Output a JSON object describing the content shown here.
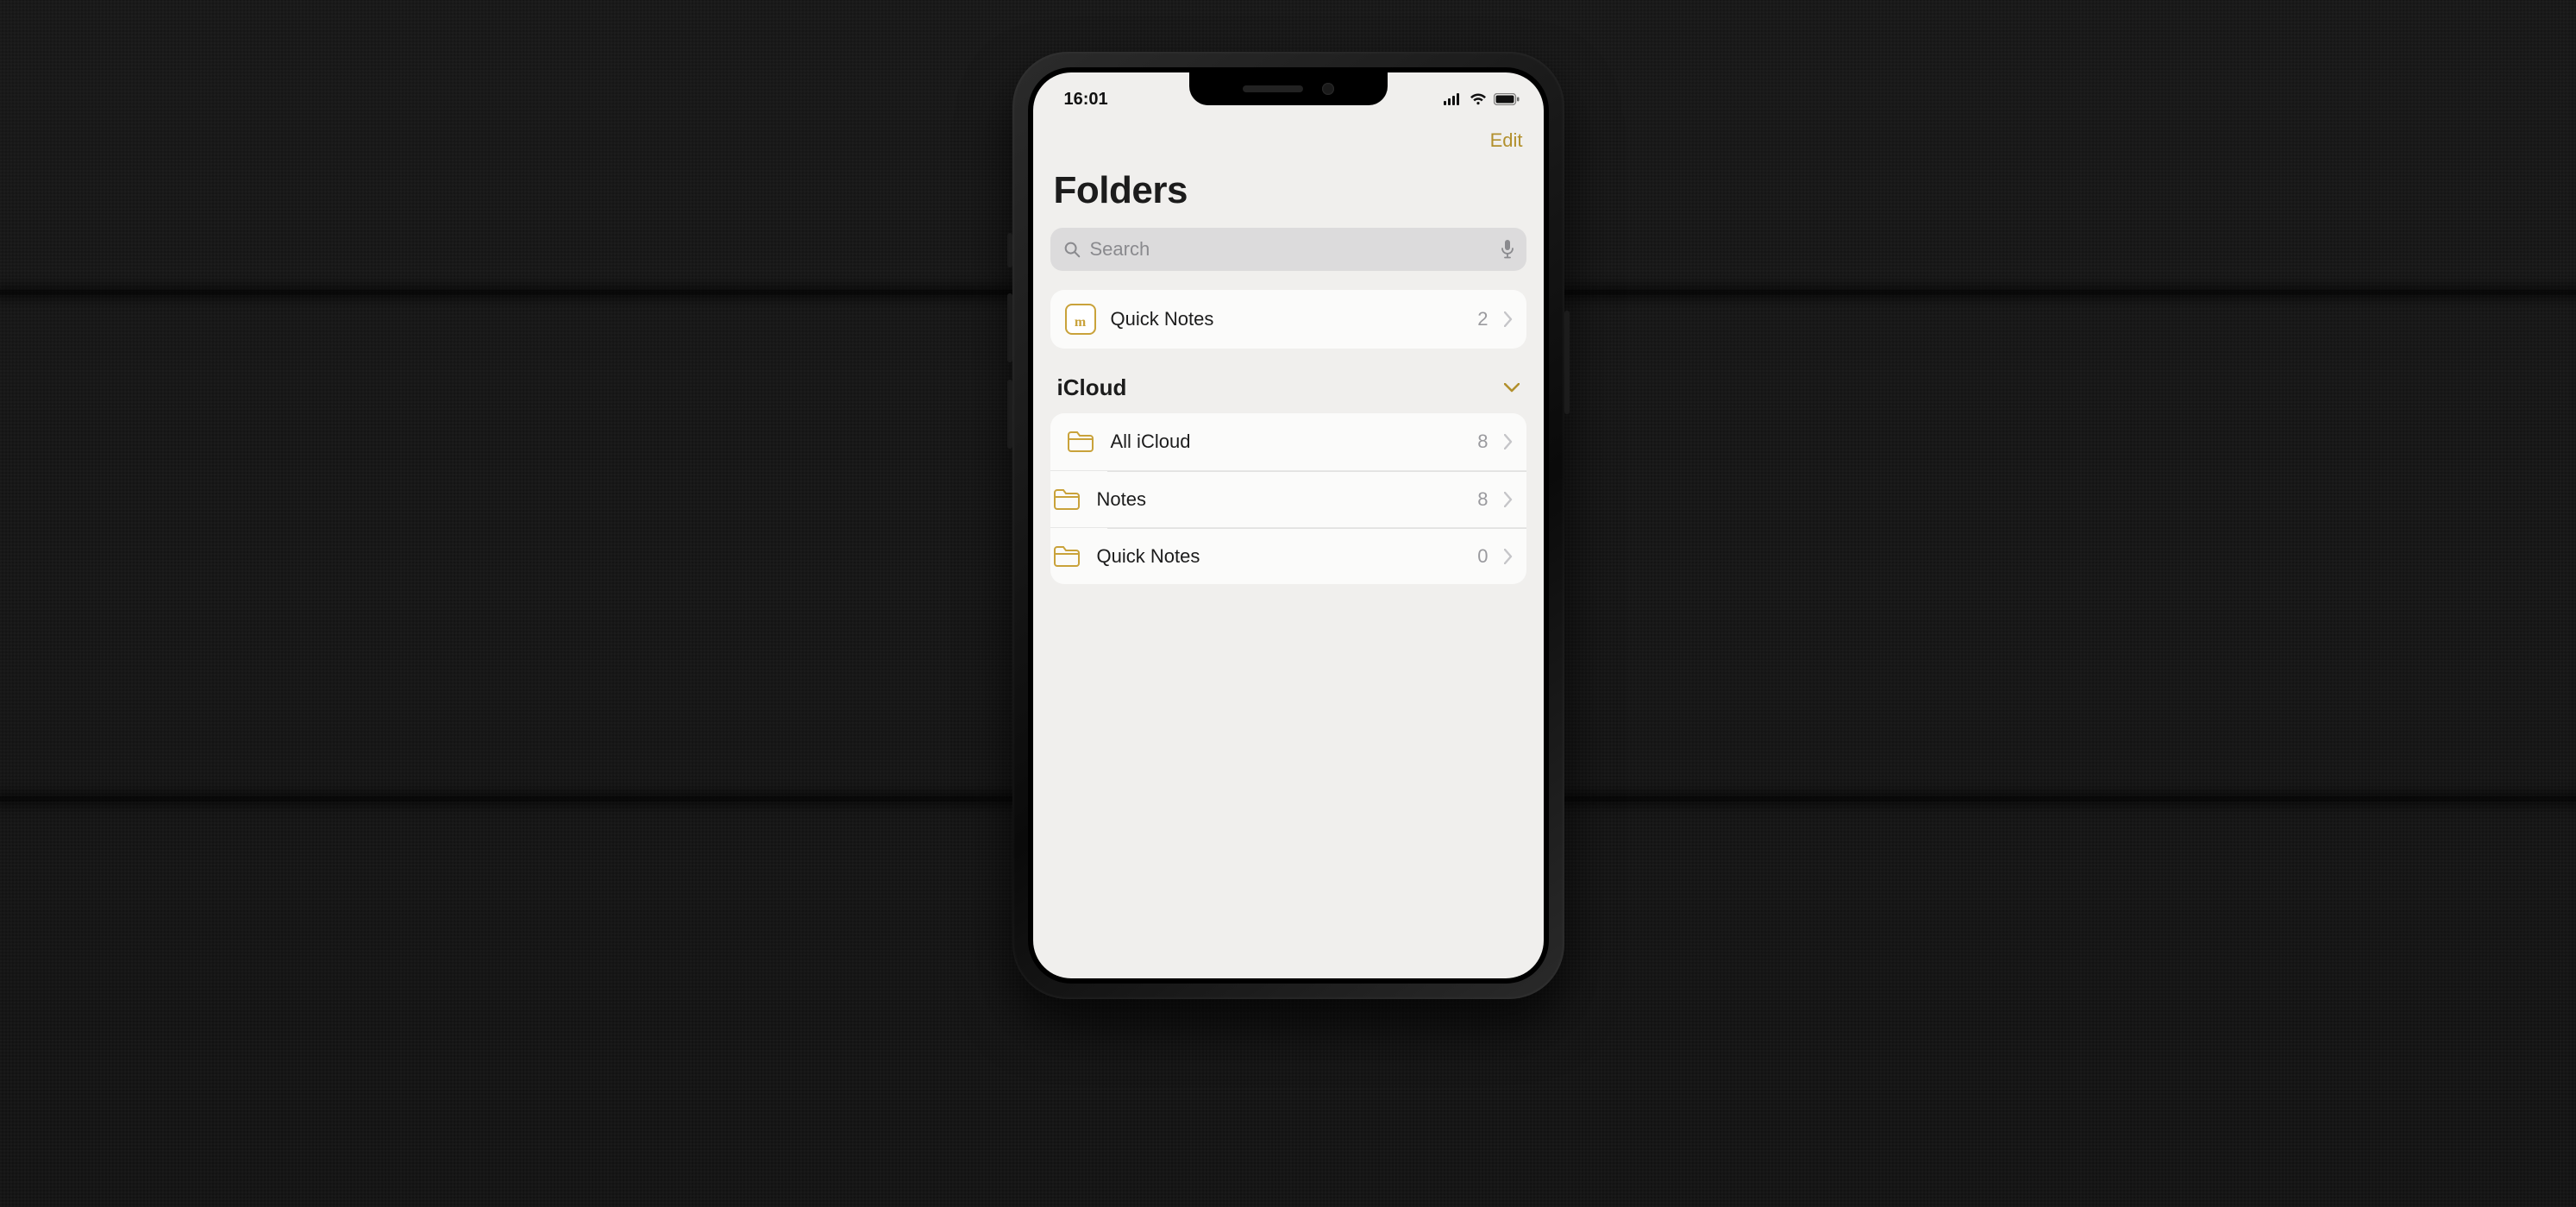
{
  "statusbar": {
    "time": "16:01"
  },
  "navbar": {
    "edit_label": "Edit"
  },
  "page": {
    "title": "Folders"
  },
  "search": {
    "placeholder": "Search"
  },
  "quick_notes": {
    "label": "Quick Notes",
    "count": "2"
  },
  "sections": [
    {
      "title": "iCloud",
      "expanded": true,
      "folders": [
        {
          "label": "All iCloud",
          "count": "8"
        },
        {
          "label": "Notes",
          "count": "8"
        },
        {
          "label": "Quick Notes",
          "count": "0"
        }
      ]
    }
  ],
  "colors": {
    "accent": "#b2902d"
  }
}
